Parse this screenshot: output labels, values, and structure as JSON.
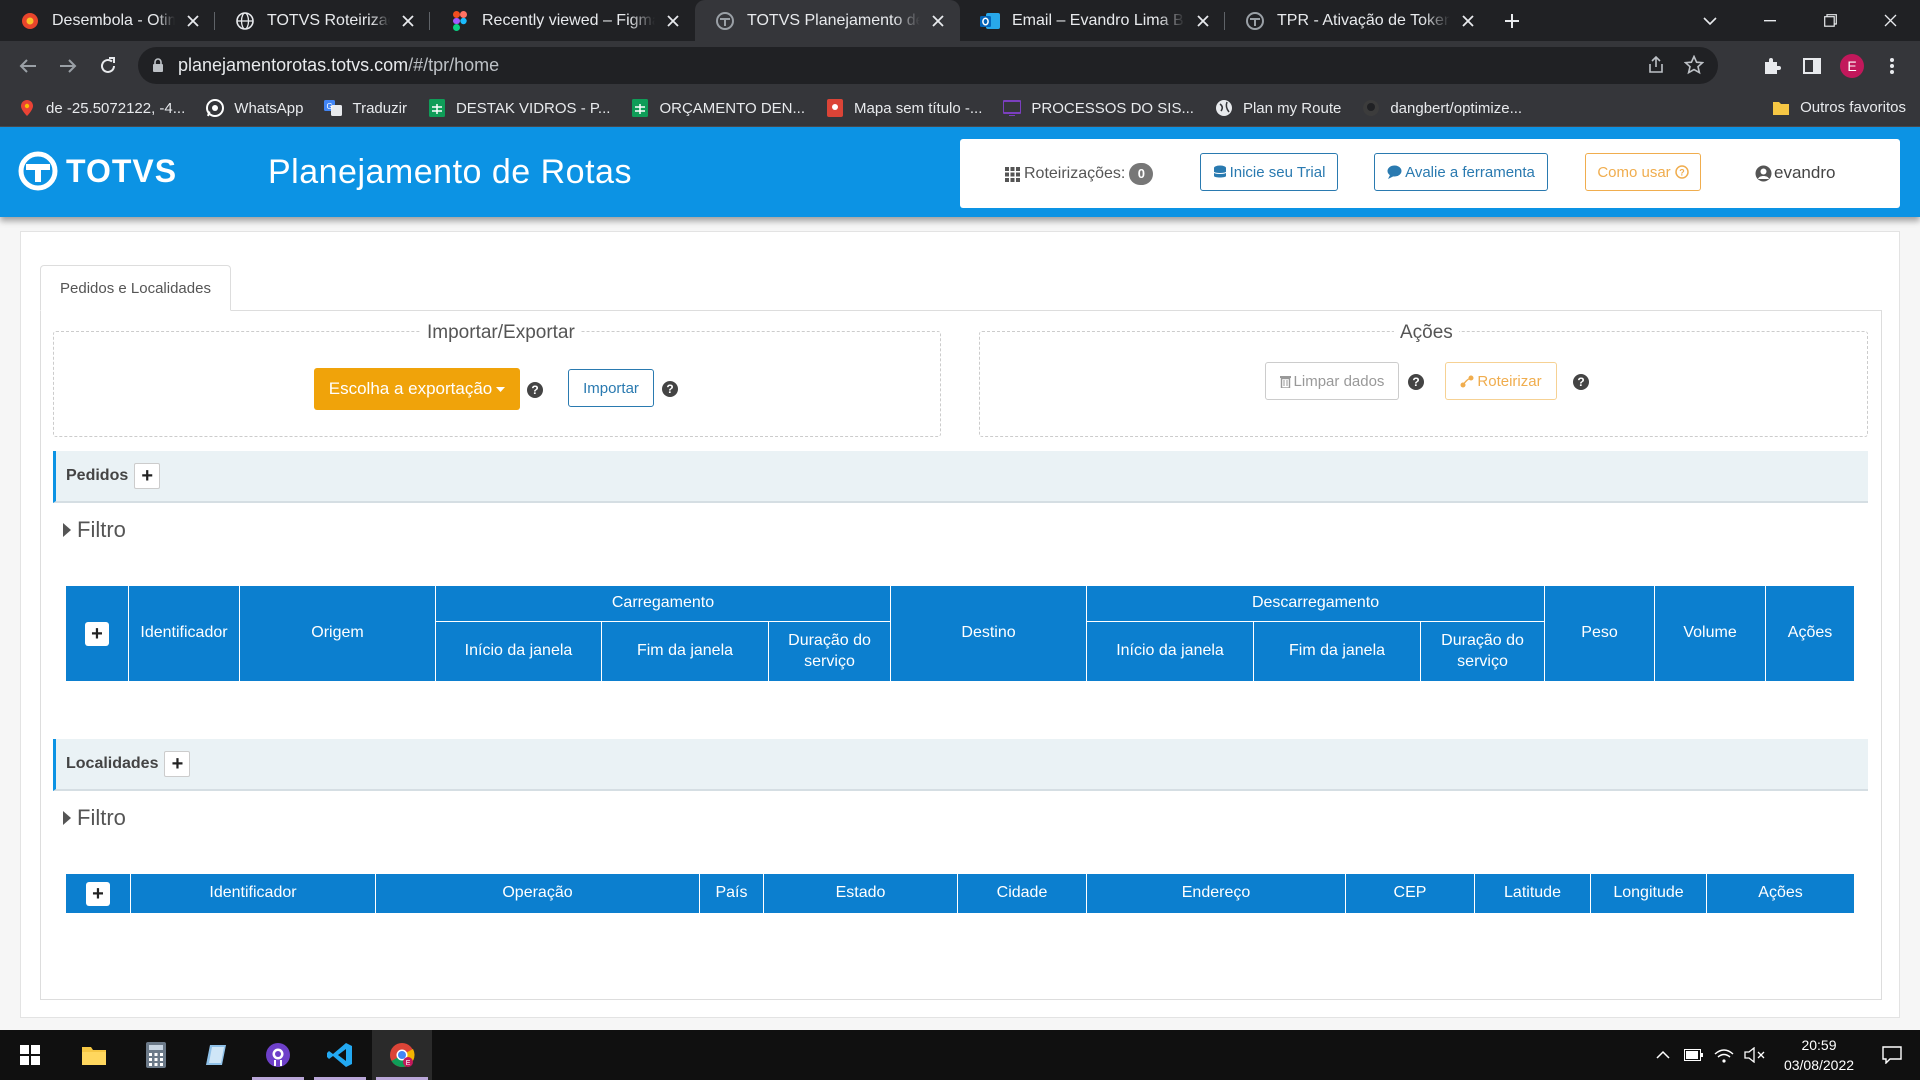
{
  "browser": {
    "tabs": [
      {
        "title": "Desembola - Otimize seu te",
        "icon": "desembola-icon",
        "active": false
      },
      {
        "title": "TOTVS Roteirização e Entreg",
        "icon": "globe-icon",
        "active": false
      },
      {
        "title": "Recently viewed – Figma",
        "icon": "figma-icon",
        "active": false
      },
      {
        "title": "TOTVS Planejamento de Ro",
        "icon": "totvs-icon",
        "active": true
      },
      {
        "title": "Email – Evandro Lima Barbo",
        "icon": "outlook-icon",
        "active": false
      },
      {
        "title": "TPR - Ativação de Token",
        "icon": "totvs-icon",
        "active": false
      }
    ],
    "url_host": "planejamentorotas.totvs.com",
    "url_path": "/#/tpr/home",
    "profile_initial": "E",
    "bookmarks": [
      {
        "label": "de -25.5072122, -4...",
        "icon": "maps-pin-icon"
      },
      {
        "label": "WhatsApp",
        "icon": "whatsapp-icon"
      },
      {
        "label": "Traduzir",
        "icon": "translate-icon"
      },
      {
        "label": "DESTAK VIDROS - P...",
        "icon": "sheets-icon"
      },
      {
        "label": "ORÇAMENTO DEN...",
        "icon": "sheets-icon"
      },
      {
        "label": "Mapa sem título -...",
        "icon": "map-marker-icon"
      },
      {
        "label": "PROCESSOS DO SIS...",
        "icon": "slides-icon"
      },
      {
        "label": "Plan my Route",
        "icon": "globe-icon"
      },
      {
        "label": "dangbert/optimize...",
        "icon": "github-icon"
      }
    ],
    "other_bookmarks": "Outros favoritos"
  },
  "header": {
    "brand": "TOTVS",
    "title": "Planejamento de Rotas",
    "routes_label": "Roteirizações:",
    "routes_count": "0",
    "trial_button": "Inicie seu Trial",
    "evaluate_button": "Avalie a ferramenta",
    "howto_button": "Como usar",
    "user": "evandro"
  },
  "main": {
    "tab_label": "Pedidos e Localidades",
    "import_export": {
      "legend": "Importar/Exportar",
      "export_button": "Escolha a exportação",
      "import_button": "Importar"
    },
    "actions": {
      "legend": "Ações",
      "clear_button": "Limpar dados",
      "route_button": "Roteirizar"
    },
    "orders": {
      "title": "Pedidos",
      "filter": "Filtro",
      "headers": {
        "identifier": "Identificador",
        "origin": "Origem",
        "loading": "Carregamento",
        "window_start": "Início da janela",
        "window_end": "Fim da janela",
        "service_duration": "Duração do serviço",
        "destination": "Destino",
        "unloading": "Descarregamento",
        "weight": "Peso",
        "volume": "Volume",
        "actions": "Ações"
      }
    },
    "locations": {
      "title": "Localidades",
      "filter": "Filtro",
      "headers": [
        "Identificador",
        "Operação",
        "País",
        "Estado",
        "Cidade",
        "Endereço",
        "CEP",
        "Latitude",
        "Longitude",
        "Ações"
      ]
    }
  },
  "taskbar": {
    "apps": [
      "file-explorer-icon",
      "calculator-icon",
      "notes-icon",
      "github-desktop-icon",
      "vscode-icon",
      "chrome-icon"
    ],
    "time": "20:59",
    "date": "03/08/2022"
  },
  "colors": {
    "brand_blue": "#0c93e4",
    "table_header": "#0c7fcf",
    "export_orange": "#f0a30a",
    "outline_blue": "#2a7ab0",
    "howto_orange": "#f0ad4e"
  }
}
